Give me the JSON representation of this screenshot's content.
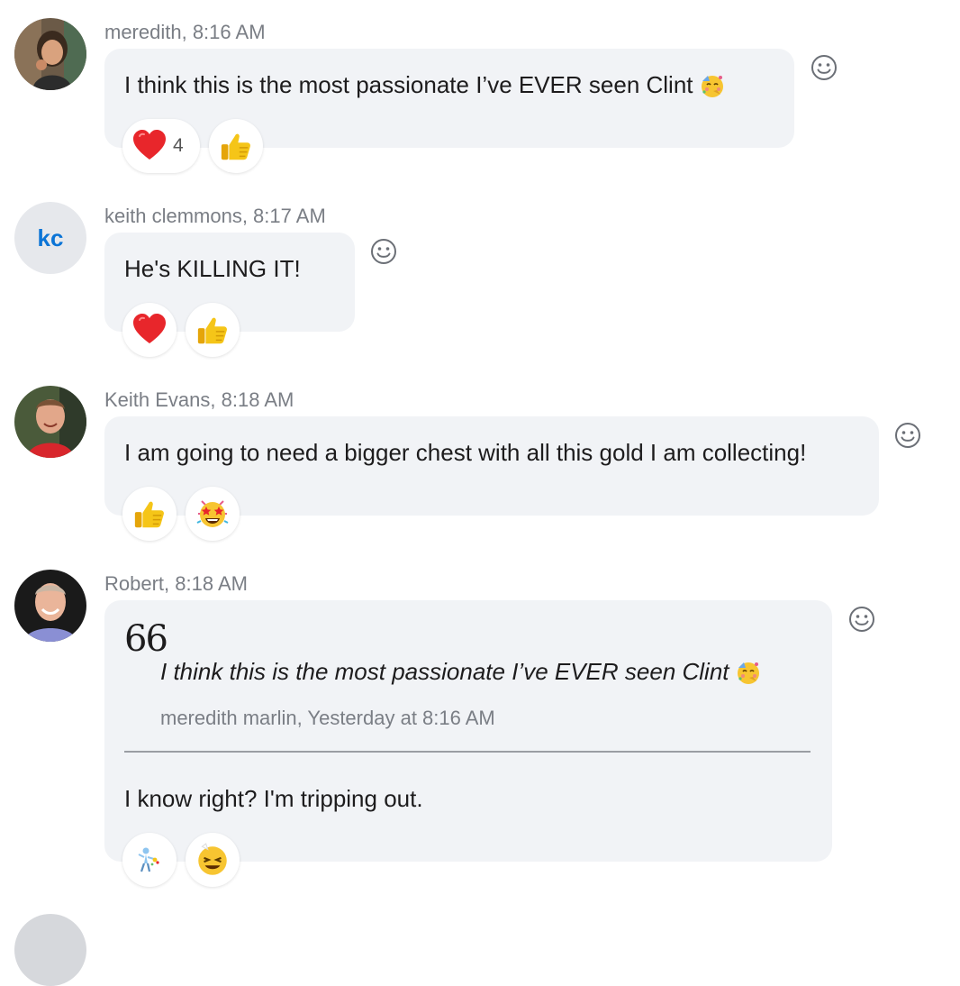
{
  "messages": [
    {
      "author": "meredith",
      "time": "8:16 AM",
      "meta": "meredith, 8:16 AM",
      "avatar": "photo-woman",
      "text": "I think this is the most passionate I’ve EVER seen Clint",
      "text_emoji": "partying-face",
      "reactions": [
        {
          "emoji": "red-heart",
          "count": "4"
        },
        {
          "emoji": "thumbs-up",
          "count": ""
        }
      ]
    },
    {
      "author": "keith clemmons",
      "time": "8:17 AM",
      "meta": "keith clemmons, 8:17 AM",
      "avatar_initials": "kc",
      "text": "He's KILLING IT!",
      "reactions": [
        {
          "emoji": "red-heart",
          "count": ""
        },
        {
          "emoji": "thumbs-up",
          "count": ""
        }
      ]
    },
    {
      "author": "Keith Evans",
      "time": "8:18 AM",
      "meta": "Keith Evans, 8:18 AM",
      "avatar": "photo-man-red-shirt",
      "text": "I am going to need a bigger chest with all this gold I am collecting!",
      "reactions": [
        {
          "emoji": "thumbs-up",
          "count": ""
        },
        {
          "emoji": "star-struck-face",
          "count": ""
        }
      ]
    },
    {
      "author": "Robert",
      "time": "8:18 AM",
      "meta": "Robert, 8:18 AM",
      "avatar": "photo-man-smiling",
      "quote": {
        "mark": "66",
        "text": "I think this is the most passionate I’ve EVER seen Clint",
        "emoji": "partying-face",
        "attribution": "meredith marlin, Yesterday at 8:16 AM"
      },
      "text": "I know right? I'm tripping out.",
      "reactions": [
        {
          "emoji": "dancing-figure",
          "count": ""
        },
        {
          "emoji": "grinning-squinting-face",
          "count": ""
        }
      ]
    }
  ],
  "colors": {
    "bubble": "#f1f3f6",
    "meta_text": "#7a7e85",
    "initials": "#0b74d6",
    "heart": "#e8262b",
    "thumbs": "#f5c518"
  }
}
